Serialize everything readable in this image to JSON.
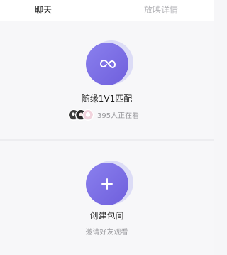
{
  "tabs": {
    "chat": "聊天",
    "detail": "放映详情"
  },
  "match": {
    "title": "随缘1V1匹配",
    "online_text": "395人正在看",
    "icon": "infinity-icon",
    "accent": "#7b6ee6"
  },
  "room": {
    "title": "创建包间",
    "subtitle": "邀请好友观看",
    "icon": "plus-icon",
    "accent": "#7b6ee6"
  }
}
